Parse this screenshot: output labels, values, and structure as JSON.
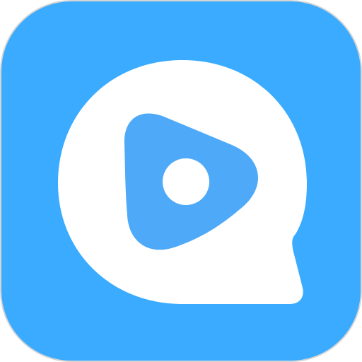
{
  "icon": {
    "name": "video-chat-app-icon",
    "glyph": "play-bubble-icon",
    "colors": {
      "tile": "#3AABFF",
      "tile_edge": "#D5D5D5",
      "bubble": "#FFFFFF",
      "play": "#4EAAF8",
      "dot": "#FFFFFF"
    }
  }
}
